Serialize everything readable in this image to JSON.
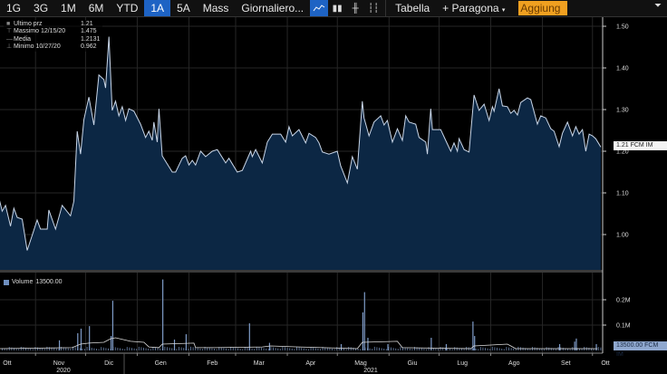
{
  "toolbar": {
    "ranges": [
      "1G",
      "3G",
      "1M",
      "6M",
      "YTD",
      "1A",
      "5A",
      "Mass"
    ],
    "selected_range": "1A",
    "frequency": "Giornaliero...",
    "chart_icons": [
      "line-chart-icon",
      "bar-chart-icon",
      "ohlc-icon",
      "candlestick-icon"
    ],
    "table_label": "Tabella",
    "compare_label": "+ Paragona",
    "add_input_value": "Aggiung",
    "filter_icon": "filter-icon"
  },
  "legend": {
    "rows": [
      {
        "label": "Ultimo prz",
        "value": "1.21"
      },
      {
        "label": "Massimo 12/15/20",
        "value": "1.475"
      },
      {
        "label": "Media",
        "value": "1.2131"
      },
      {
        "label": "Minimo 10/27/20",
        "value": "0.962"
      }
    ]
  },
  "volume_legend": {
    "label": "Volume",
    "value": "13500.00"
  },
  "last_price_label": "1.21 FCM IM",
  "last_volume_label": "13500.00 FCM IM",
  "colors": {
    "line": "#c9d6e8",
    "area": "#0c2744",
    "volume": "#7f9cc8",
    "accent": "#1e63c4",
    "input": "#f0a020"
  },
  "chart_data": [
    {
      "type": "area",
      "ylim": [
        0.93,
        1.52
      ],
      "yticks": [
        "1.50",
        "1.40",
        "1.30",
        "1.20",
        "1.10",
        "1.00"
      ],
      "ytick_values": [
        1.5,
        1.4,
        1.3,
        1.2,
        1.1,
        1.0
      ],
      "grid": true,
      "points": [
        [
          "2020-10-10",
          1.089
        ],
        [
          "2020-10-12",
          1.056
        ],
        [
          "2020-10-14",
          1.07
        ],
        [
          "2020-10-17",
          1.02
        ],
        [
          "2020-10-19",
          1.063
        ],
        [
          "2020-10-21",
          1.041
        ],
        [
          "2020-10-24",
          1.037
        ],
        [
          "2020-10-27",
          0.962
        ],
        [
          "2020-10-30",
          0.998
        ],
        [
          "2020-11-02",
          1.035
        ],
        [
          "2020-11-04",
          1.013
        ],
        [
          "2020-11-08",
          1.013
        ],
        [
          "2020-11-09",
          1.059
        ],
        [
          "2020-11-13",
          1.013
        ],
        [
          "2020-11-17",
          1.07
        ],
        [
          "2020-11-22",
          1.045
        ],
        [
          "2020-11-24",
          1.08
        ],
        [
          "2020-11-26",
          1.248
        ],
        [
          "2020-11-28",
          1.193
        ],
        [
          "2020-11-30",
          1.276
        ],
        [
          "2020-12-03",
          1.33
        ],
        [
          "2020-12-06",
          1.263
        ],
        [
          "2020-12-09",
          1.383
        ],
        [
          "2020-12-12",
          1.372
        ],
        [
          "2020-12-13",
          1.352
        ],
        [
          "2020-12-15",
          1.475
        ],
        [
          "2020-12-17",
          1.298
        ],
        [
          "2020-12-19",
          1.32
        ],
        [
          "2020-12-21",
          1.285
        ],
        [
          "2020-12-23",
          1.307
        ],
        [
          "2020-12-25",
          1.274
        ],
        [
          "2020-12-27",
          1.302
        ],
        [
          "2020-12-30",
          1.296
        ],
        [
          "2021-01-03",
          1.265
        ],
        [
          "2021-01-06",
          1.233
        ],
        [
          "2021-01-08",
          1.248
        ],
        [
          "2021-01-10",
          1.226
        ],
        [
          "2021-01-11",
          1.27
        ],
        [
          "2021-01-13",
          1.222
        ],
        [
          "2021-01-14",
          1.302
        ],
        [
          "2021-01-16",
          1.189
        ],
        [
          "2021-01-22",
          1.15
        ],
        [
          "2021-01-24",
          1.15
        ],
        [
          "2021-01-28",
          1.183
        ],
        [
          "2021-01-30",
          1.189
        ],
        [
          "2021-02-01",
          1.167
        ],
        [
          "2021-02-03",
          1.178
        ],
        [
          "2021-02-05",
          1.167
        ],
        [
          "2021-02-08",
          1.2
        ],
        [
          "2021-02-11",
          1.187
        ],
        [
          "2021-02-15",
          1.2
        ],
        [
          "2021-02-18",
          1.204
        ],
        [
          "2021-02-23",
          1.172
        ],
        [
          "2021-02-25",
          1.183
        ],
        [
          "2021-03-02",
          1.15
        ],
        [
          "2021-03-05",
          1.154
        ],
        [
          "2021-03-10",
          1.2
        ],
        [
          "2021-03-11",
          1.187
        ],
        [
          "2021-03-13",
          1.204
        ],
        [
          "2021-03-17",
          1.172
        ],
        [
          "2021-03-20",
          1.222
        ],
        [
          "2021-03-23",
          1.241
        ],
        [
          "2021-03-28",
          1.241
        ],
        [
          "2021-03-31",
          1.222
        ],
        [
          "2021-04-02",
          1.259
        ],
        [
          "2021-04-04",
          1.237
        ],
        [
          "2021-04-08",
          1.252
        ],
        [
          "2021-04-12",
          1.22
        ],
        [
          "2021-04-14",
          1.243
        ],
        [
          "2021-04-18",
          1.233
        ],
        [
          "2021-04-20",
          1.22
        ],
        [
          "2021-04-22",
          1.198
        ],
        [
          "2021-04-26",
          1.193
        ],
        [
          "2021-05-01",
          1.2
        ],
        [
          "2021-05-03",
          1.165
        ],
        [
          "2021-05-07",
          1.124
        ],
        [
          "2021-05-10",
          1.187
        ],
        [
          "2021-05-13",
          1.157
        ],
        [
          "2021-05-16",
          1.32
        ],
        [
          "2021-05-17",
          1.28
        ],
        [
          "2021-05-20",
          1.237
        ],
        [
          "2021-05-23",
          1.27
        ],
        [
          "2021-05-27",
          1.285
        ],
        [
          "2021-05-29",
          1.263
        ],
        [
          "2021-05-31",
          1.274
        ],
        [
          "2021-06-03",
          1.222
        ],
        [
          "2021-06-06",
          1.254
        ],
        [
          "2021-06-09",
          1.226
        ],
        [
          "2021-06-11",
          1.285
        ],
        [
          "2021-06-13",
          1.27
        ],
        [
          "2021-06-17",
          1.265
        ],
        [
          "2021-06-19",
          1.233
        ],
        [
          "2021-06-23",
          1.222
        ],
        [
          "2021-06-24",
          1.193
        ],
        [
          "2021-06-26",
          1.302
        ],
        [
          "2021-06-27",
          1.252
        ],
        [
          "2021-07-02",
          1.252
        ],
        [
          "2021-07-05",
          1.226
        ],
        [
          "2021-07-08",
          1.2
        ],
        [
          "2021-07-10",
          1.22
        ],
        [
          "2021-07-12",
          1.2
        ],
        [
          "2021-07-13",
          1.23
        ],
        [
          "2021-07-16",
          1.204
        ],
        [
          "2021-07-19",
          1.198
        ],
        [
          "2021-07-22",
          1.335
        ],
        [
          "2021-07-25",
          1.298
        ],
        [
          "2021-07-28",
          1.313
        ],
        [
          "2021-07-31",
          1.274
        ],
        [
          "2021-08-02",
          1.307
        ],
        [
          "2021-08-03",
          1.296
        ],
        [
          "2021-08-06",
          1.35
        ],
        [
          "2021-08-08",
          1.309
        ],
        [
          "2021-08-11",
          1.307
        ],
        [
          "2021-08-13",
          1.291
        ],
        [
          "2021-08-15",
          1.298
        ],
        [
          "2021-08-17",
          1.287
        ],
        [
          "2021-08-19",
          1.317
        ],
        [
          "2021-08-23",
          1.328
        ],
        [
          "2021-08-25",
          1.324
        ],
        [
          "2021-08-29",
          1.265
        ],
        [
          "2021-08-31",
          1.285
        ],
        [
          "2021-09-03",
          1.28
        ],
        [
          "2021-09-06",
          1.254
        ],
        [
          "2021-09-08",
          1.248
        ],
        [
          "2021-09-11",
          1.211
        ],
        [
          "2021-09-13",
          1.243
        ],
        [
          "2021-09-16",
          1.27
        ],
        [
          "2021-09-19",
          1.237
        ],
        [
          "2021-09-21",
          1.259
        ],
        [
          "2021-09-23",
          1.241
        ],
        [
          "2021-09-25",
          1.252
        ],
        [
          "2021-09-27",
          1.2
        ],
        [
          "2021-09-29",
          1.241
        ],
        [
          "2021-10-01",
          1.237
        ],
        [
          "2021-10-03",
          1.23
        ],
        [
          "2021-10-06",
          1.21
        ]
      ]
    },
    {
      "type": "bar",
      "unit": "M",
      "ylim": [
        0,
        0.29
      ],
      "yticks": [
        "0.2M",
        "0.1M"
      ],
      "ytick_values": [
        0.2,
        0.1
      ],
      "base_volume": 0.01,
      "spikes": [
        [
          "2020-11-15",
          0.04
        ],
        [
          "2020-11-26",
          0.068
        ],
        [
          "2020-11-28",
          0.086
        ],
        [
          "2020-12-03",
          0.096
        ],
        [
          "2020-12-16",
          0.057
        ],
        [
          "2020-12-17",
          0.196
        ],
        [
          "2021-01-16",
          0.28
        ],
        [
          "2021-01-23",
          0.043
        ],
        [
          "2021-01-30",
          0.064
        ],
        [
          "2021-03-09",
          0.107
        ],
        [
          "2021-03-21",
          0.03
        ],
        [
          "2021-05-03",
          0.025
        ],
        [
          "2021-05-16",
          0.15
        ],
        [
          "2021-05-17",
          0.23
        ],
        [
          "2021-05-19",
          0.05
        ],
        [
          "2021-05-31",
          0.025
        ],
        [
          "2021-06-26",
          0.05
        ],
        [
          "2021-07-05",
          0.025
        ],
        [
          "2021-07-21",
          0.114
        ],
        [
          "2021-07-22",
          0.057
        ],
        [
          "2021-09-11",
          0.025
        ],
        [
          "2021-09-20",
          0.035
        ],
        [
          "2021-09-21",
          0.047
        ],
        [
          "2021-10-03",
          0.025
        ]
      ],
      "moving_average": [
        [
          "2020-10-10",
          0.007
        ],
        [
          "2020-11-23",
          0.011
        ],
        [
          "2020-11-28",
          0.025
        ],
        [
          "2020-12-03",
          0.029
        ],
        [
          "2020-12-12",
          0.032
        ],
        [
          "2020-12-16",
          0.046
        ],
        [
          "2020-12-19",
          0.05
        ],
        [
          "2020-12-28",
          0.036
        ],
        [
          "2021-01-05",
          0.032
        ],
        [
          "2021-01-08",
          0.014
        ],
        [
          "2021-01-14",
          0.011
        ],
        [
          "2021-01-16",
          0.025
        ],
        [
          "2021-02-04",
          0.029
        ],
        [
          "2021-02-05",
          0.011
        ],
        [
          "2021-02-17",
          0.011
        ],
        [
          "2021-03-17",
          0.014
        ],
        [
          "2021-03-22",
          0.018
        ],
        [
          "2021-04-08",
          0.014
        ],
        [
          "2021-05-13",
          0.007
        ],
        [
          "2021-05-16",
          0.032
        ],
        [
          "2021-06-06",
          0.036
        ],
        [
          "2021-06-09",
          0.011
        ],
        [
          "2021-07-20",
          0.007
        ],
        [
          "2021-07-22",
          0.018
        ],
        [
          "2021-08-11",
          0.025
        ],
        [
          "2021-08-13",
          0.018
        ],
        [
          "2021-08-16",
          0.007
        ],
        [
          "2021-09-20",
          0.007
        ],
        [
          "2021-10-04",
          0.007
        ]
      ]
    }
  ],
  "x_axis": {
    "months": [
      "Ott",
      "Nov",
      "Dic",
      "Gen",
      "Feb",
      "Mar",
      "Apr",
      "Mag",
      "Giu",
      "Lug",
      "Ago",
      "Set",
      "Ott"
    ],
    "years": [
      "2020",
      "2021"
    ]
  }
}
